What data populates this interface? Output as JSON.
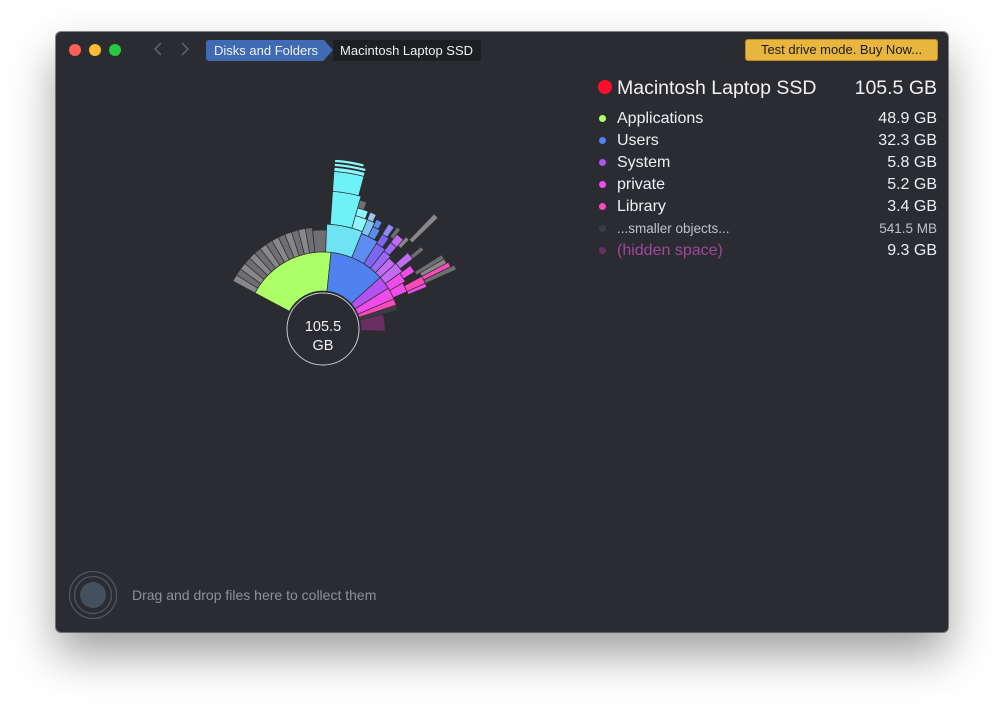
{
  "titlebar": {
    "breadcrumb": [
      "Disks and Folders",
      "Macintosh Laptop SSD"
    ],
    "buy_label": "Test drive mode. Buy Now..."
  },
  "disk": {
    "name": "Macintosh Laptop SSD",
    "size": "105.5 GB",
    "dot_color": "#ff0d2e"
  },
  "legend": [
    {
      "name": "Applications",
      "size": "48.9 GB",
      "color": "#adff68"
    },
    {
      "name": "Users",
      "size": "32.3 GB",
      "color": "#4f82ee"
    },
    {
      "name": "System",
      "size": "5.8 GB",
      "color": "#b351f1"
    },
    {
      "name": "private",
      "size": "5.2 GB",
      "color": "#f04ce9"
    },
    {
      "name": "Library",
      "size": "3.4 GB",
      "color": "#ff49ba"
    },
    {
      "name": "...smaller objects...",
      "size": "541.5  MB",
      "color": "#3a3d43"
    },
    {
      "name": "(hidden space)",
      "size": "9.3 GB",
      "color": "#6a2e63"
    }
  ],
  "center": {
    "value": "105.5",
    "unit": "GB"
  },
  "dropzone": {
    "text": "Drag and drop files here to collect them"
  }
}
